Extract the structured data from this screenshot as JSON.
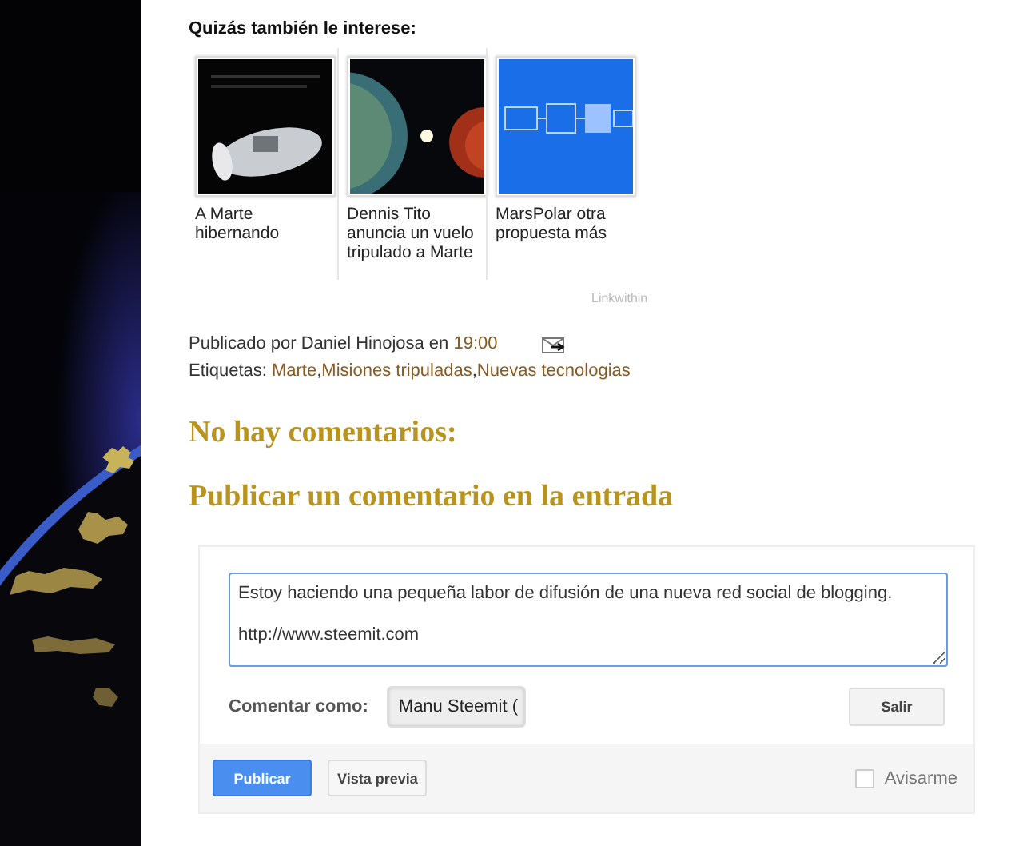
{
  "related": {
    "heading": "Quizás también le interese:",
    "items": [
      {
        "kind": "picture",
        "caption": "A Marte hibernando"
      },
      {
        "kind": "picture",
        "caption": "Dennis Tito anuncia un vuelo tripulado a Marte"
      },
      {
        "kind": "picture",
        "caption": "MarsPolar otra propuesta más"
      }
    ],
    "credit": "Linkwithin"
  },
  "post_footer": {
    "byline": "Publicado por Daniel Hinojosa en",
    "time": "19:00",
    "labels_title": "Etiquetas:",
    "labels": [
      "Marte",
      "Misiones tripuladas",
      "Nuevas tecnologias"
    ],
    "separator": ","
  },
  "comments": {
    "count_heading": "No hay comentarios:",
    "form_heading": "Publicar un comentario en la entrada",
    "form": {
      "text": "Estoy haciendo una pequeña labor de difusión de una nueva red social de blogging.\n\nhttp://www.steemit.com",
      "comment_as": "Comentar como:",
      "identity": "Manu Steemit (",
      "sign_out": "Salir",
      "publish": "Publicar",
      "preview": "Vista previa",
      "notify": {
        "label": "Avisarme",
        "checked": false
      }
    }
  }
}
